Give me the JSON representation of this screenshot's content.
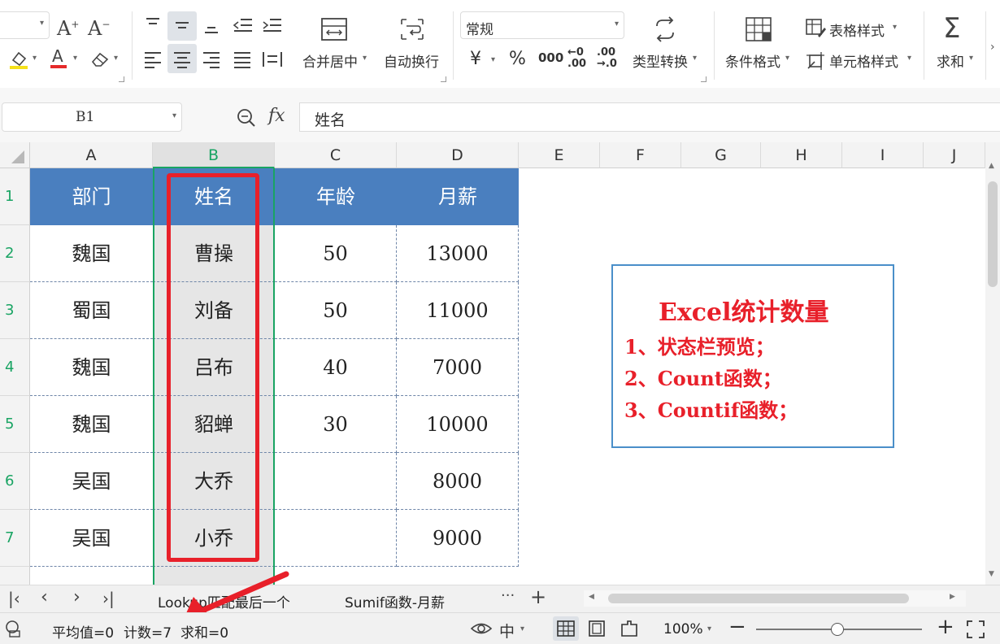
{
  "ribbon": {
    "font_size_value": "",
    "align_group": {
      "merge_label": "合并居中",
      "wrap_label": "自动换行"
    },
    "number_format": {
      "value": "常规",
      "currency": "¥",
      "percent": "%",
      "thousands": "000",
      "inc_decimal": "←0\n.00",
      "dec_decimal": ".00\n→.0",
      "convert_label": "类型转换"
    },
    "styles": {
      "cond_format_label": "条件格式",
      "table_style_label": "表格样式",
      "cell_style_label": "单元格样式"
    },
    "sum_label": "求和"
  },
  "formula_bar": {
    "name_box": "B1",
    "fx": "fx",
    "content": "姓名"
  },
  "columns": [
    "A",
    "B",
    "C",
    "D",
    "E",
    "F",
    "G",
    "H",
    "I",
    "J"
  ],
  "rows": [
    "1",
    "2",
    "3",
    "4",
    "5",
    "6",
    "7"
  ],
  "table": {
    "headers": [
      "部门",
      "姓名",
      "年龄",
      "月薪"
    ],
    "data": [
      [
        "魏国",
        "曹操",
        "50",
        "13000"
      ],
      [
        "蜀国",
        "刘备",
        "50",
        "11000"
      ],
      [
        "魏国",
        "吕布",
        "40",
        "7000"
      ],
      [
        "魏国",
        "貂蝉",
        "30",
        "10000"
      ],
      [
        "吴国",
        "大乔",
        "",
        "8000"
      ],
      [
        "吴国",
        "小乔",
        "",
        "9000"
      ]
    ]
  },
  "note": {
    "title": "Excel统计数量",
    "lines": [
      "1、状态栏预览；",
      "2、Count函数；",
      "3、Countif函数；"
    ]
  },
  "sheet_tabs": [
    "Lookup匹配最后一个",
    "Sumif函数-月薪"
  ],
  "status": {
    "average": "平均值=0",
    "count": "计数=7",
    "sum": "求和=0",
    "zoom": "100%"
  },
  "colors": {
    "header_fill": "#4a7fbf",
    "selection_green": "#19a463",
    "annotation_red": "#e8202a",
    "note_border": "#4a8fc9"
  }
}
